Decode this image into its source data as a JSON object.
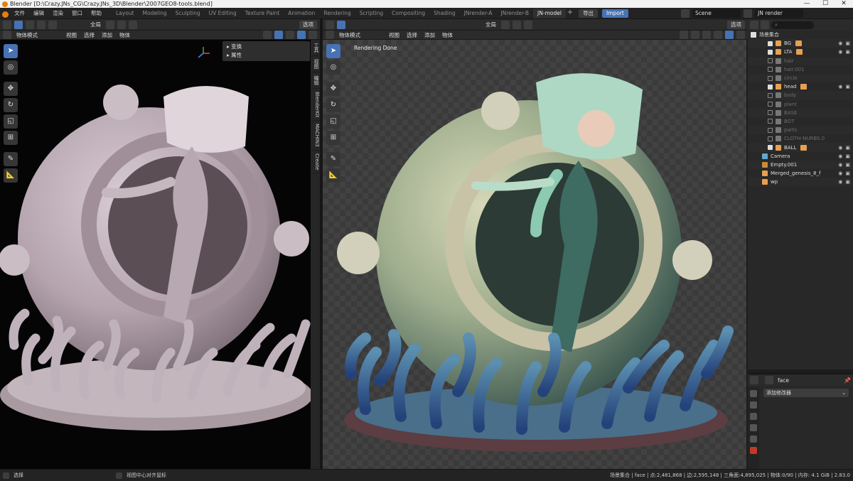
{
  "window": {
    "title": "Blender [D:\\Crazy.JNs_CG\\Crazy.JNs_3D\\Blender\\2007GEO8-tools.blend]",
    "controls": [
      "—",
      "☐",
      "✕"
    ]
  },
  "menu": {
    "items": [
      "文件",
      "编辑",
      "渲染",
      "窗口",
      "帮助"
    ]
  },
  "workspaces": {
    "tabs": [
      "Layout",
      "Modeling",
      "Sculpting",
      "UV Editing",
      "Texture Paint",
      "Animation",
      "Rendering",
      "Scripting",
      "Compositing",
      "Shading",
      "JNrender-A",
      "JNrender-B",
      "JN-model"
    ],
    "active": "JN-model",
    "out_label": "导出",
    "import_label": "Import"
  },
  "scene": {
    "name": "Scene",
    "layer": "JN render"
  },
  "left_view": {
    "mode": "物体模式",
    "menus": [
      "视图",
      "选择",
      "添加",
      "物体"
    ],
    "orient": "全局",
    "options": "选项",
    "npanel": [
      "变换",
      "属性"
    ],
    "side_tabs": [
      "工具",
      "视图",
      "编辑",
      "BlenderKit",
      "MACHIN3",
      "Create"
    ]
  },
  "right_view": {
    "mode": "物体模式",
    "menus": [
      "视图",
      "选择",
      "添加",
      "物体"
    ],
    "orient": "全局",
    "options": "选项",
    "status": "Rendering Done"
  },
  "outliner": {
    "title": "场景集合",
    "search_placeholder": "",
    "rows": [
      {
        "name": "BG",
        "checked": true,
        "dim": false,
        "color": "#e8a04e",
        "mod": true
      },
      {
        "name": "LTA",
        "checked": true,
        "dim": false,
        "color": "#e8a04e",
        "mod": true
      },
      {
        "name": "hair",
        "checked": false,
        "dim": true,
        "color": "#777",
        "mod": false
      },
      {
        "name": "hair.001",
        "checked": false,
        "dim": true,
        "color": "#777",
        "mod": false
      },
      {
        "name": "circle",
        "checked": false,
        "dim": true,
        "color": "#777",
        "mod": false
      },
      {
        "name": "head",
        "checked": true,
        "dim": false,
        "color": "#e8a04e",
        "mod": true
      },
      {
        "name": "body",
        "checked": false,
        "dim": true,
        "color": "#777",
        "mod": false
      },
      {
        "name": "plant",
        "checked": false,
        "dim": true,
        "color": "#777",
        "mod": false
      },
      {
        "name": "BASE",
        "checked": false,
        "dim": true,
        "color": "#777",
        "mod": false
      },
      {
        "name": "BOT",
        "checked": false,
        "dim": true,
        "color": "#777",
        "mod": false
      },
      {
        "name": "parts",
        "checked": false,
        "dim": true,
        "color": "#777",
        "mod": false
      },
      {
        "name": "CLOTH-NURBS.0",
        "checked": false,
        "dim": true,
        "color": "#777",
        "mod": false
      },
      {
        "name": "BALL",
        "checked": true,
        "dim": false,
        "color": "#e8a04e",
        "mod": true
      },
      {
        "name": "Camera",
        "checked": null,
        "dim": false,
        "color": "#5fa8d3",
        "mod": false
      },
      {
        "name": "Empty.001",
        "checked": null,
        "dim": false,
        "color": "#c98a3a",
        "mod": false
      },
      {
        "name": "Merged_genesis_8_f",
        "checked": null,
        "dim": false,
        "color": "#e8a04e",
        "mod": false
      },
      {
        "name": "wp",
        "checked": null,
        "dim": false,
        "color": "#e8a04e",
        "mod": false
      }
    ]
  },
  "properties": {
    "object": "face",
    "add_modifier": "添加修改器"
  },
  "statusbar": {
    "left": "选择",
    "mid": "视图中心对齐鼠标",
    "right": "场景集合 | face | 点:2,481,868 | 边:2,595,148 | 三角面:4,895,025 | 物体:0/90 | 内存: 4.1 GiB | 2.83.0"
  },
  "colors": {
    "accent": "#4772b3",
    "orange": "#e8a04e",
    "bg": "#1d1d1d"
  }
}
